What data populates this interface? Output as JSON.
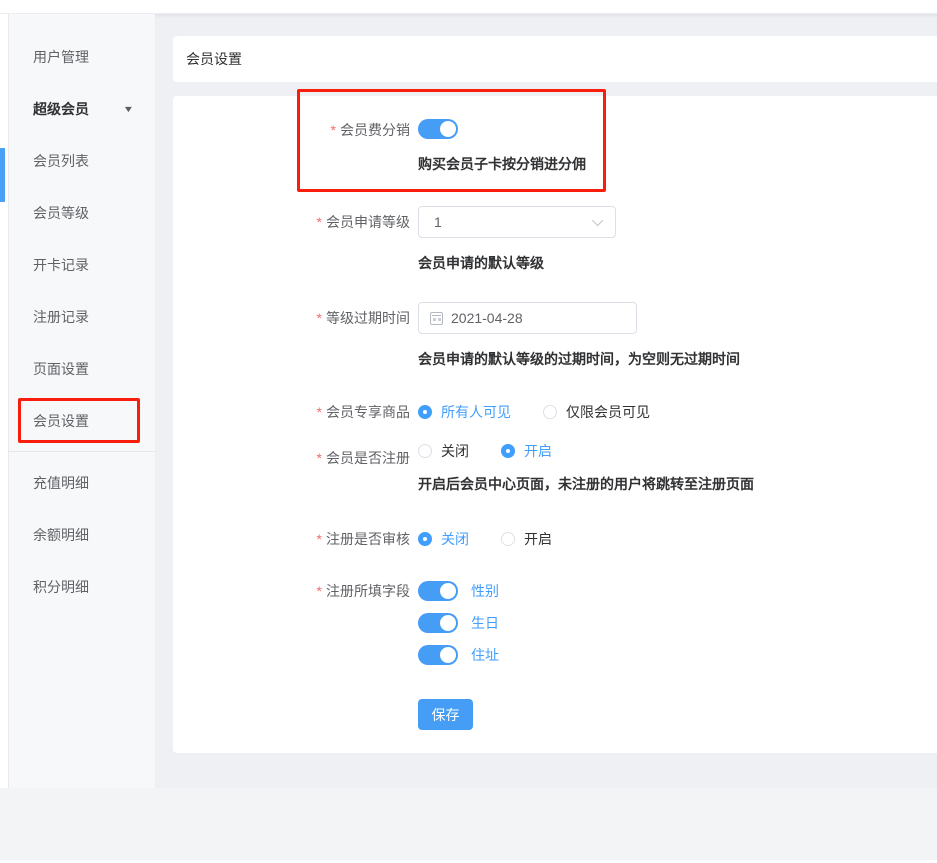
{
  "colors": {
    "accent_blue": "#409eff",
    "switch_blue": "#459df5",
    "annotation_red": "#f81d0d",
    "content_bg": "#eef0f3"
  },
  "sidebar": {
    "items": [
      {
        "label": "用户管理"
      },
      {
        "label": "超级会员"
      },
      {
        "label": "会员列表"
      },
      {
        "label": "会员等级"
      },
      {
        "label": "开卡记录"
      },
      {
        "label": "注册记录"
      },
      {
        "label": "页面设置"
      },
      {
        "label": "会员设置"
      },
      {
        "label": "充值明细"
      },
      {
        "label": "余额明细"
      },
      {
        "label": "积分明细"
      }
    ]
  },
  "header": {
    "title": "会员设置"
  },
  "form": {
    "required_mark": "*",
    "rows": {
      "fee": {
        "label": "会员费分销",
        "switch_state": "on",
        "helper": "购买会员子卡按分销进分佣"
      },
      "apply_level": {
        "label": "会员申请等级",
        "value": "1",
        "helper": "会员申请的默认等级"
      },
      "expire_time": {
        "label": "等级过期时间",
        "value": "2021-04-28",
        "helper": "会员申请的默认等级的过期时间，为空则无过期时间"
      },
      "exclusive_goods": {
        "label": "会员专享商品",
        "options": [
          {
            "label": "所有人可见",
            "checked": true
          },
          {
            "label": "仅限会员可见",
            "checked": false
          }
        ]
      },
      "need_register": {
        "label": "会员是否注册",
        "options": [
          {
            "label": "关闭",
            "checked": false
          },
          {
            "label": "开启",
            "checked": true
          }
        ],
        "helper": "开启后会员中心页面，未注册的用户将跳转至注册页面"
      },
      "register_audit": {
        "label": "注册是否审核",
        "options": [
          {
            "label": "关闭",
            "checked": true
          },
          {
            "label": "开启",
            "checked": false
          }
        ]
      },
      "register_fields": {
        "label": "注册所填字段",
        "switches": [
          {
            "label": "性别",
            "on": true
          },
          {
            "label": "生日",
            "on": true
          },
          {
            "label": "住址",
            "on": true
          }
        ]
      }
    },
    "save_label": "保存"
  }
}
